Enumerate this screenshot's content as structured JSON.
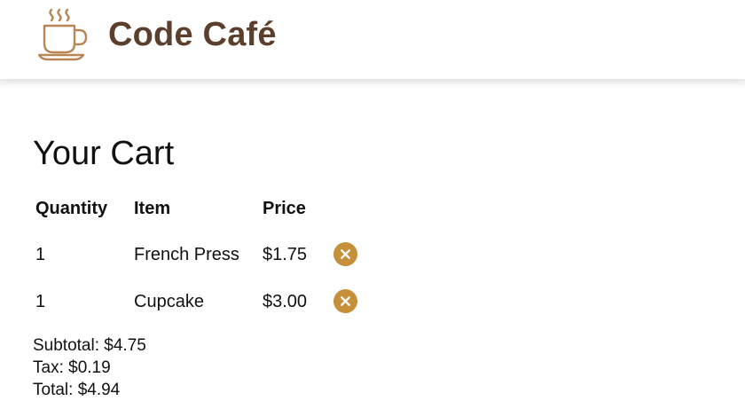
{
  "header": {
    "brand": "Code Café",
    "logo_icon": "coffee-cup-icon",
    "brand_color": "#5b3f2c",
    "icon_color": "#b98555"
  },
  "cart": {
    "title": "Your Cart",
    "columns": {
      "quantity": "Quantity",
      "item": "Item",
      "price": "Price"
    },
    "rows": [
      {
        "quantity": "1",
        "item": "French Press",
        "price": "$1.75",
        "remove_icon": "close-circle-icon"
      },
      {
        "quantity": "1",
        "item": "Cupcake",
        "price": "$3.00",
        "remove_icon": "close-circle-icon"
      }
    ],
    "accent_color": "#c6903a"
  },
  "summary": {
    "subtotal": "Subtotal: $4.75",
    "tax": "Tax: $0.19",
    "total": "Total: $4.94"
  }
}
